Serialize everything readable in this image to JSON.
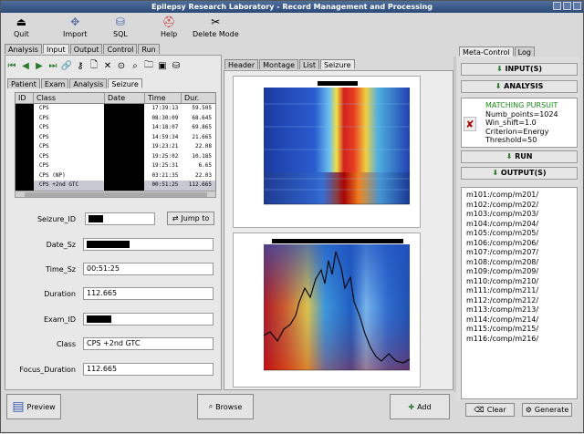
{
  "window": {
    "title": "Epilepsy Research Laboratory - Record Management and Processing"
  },
  "toolbar": [
    {
      "label": "Quit",
      "icon": "quit-icon"
    },
    {
      "label": "Import",
      "icon": "import-icon"
    },
    {
      "label": "SQL",
      "icon": "database-icon"
    },
    {
      "label": "Help",
      "icon": "help-icon"
    },
    {
      "label": "Delete Mode",
      "icon": "delete-mode-icon"
    }
  ],
  "main_tabs": [
    "Analysis",
    "Input",
    "Output",
    "Control",
    "Run"
  ],
  "sub_tabs": [
    "Patient",
    "Exam",
    "Analysis",
    "Seizure"
  ],
  "view_tabs": [
    "Header",
    "Montage",
    "List",
    "Seizure"
  ],
  "table": {
    "headers": [
      "ID",
      "Class",
      "Date",
      "Time",
      "Dur."
    ],
    "rows": [
      {
        "class": "CPS",
        "time": "17:39:13",
        "dur": "59.505"
      },
      {
        "class": "CPS",
        "time": "08:30:09",
        "dur": "68.645"
      },
      {
        "class": "CPS",
        "time": "14:18:07",
        "dur": "69.865"
      },
      {
        "class": "CPS",
        "time": "14:59:34",
        "dur": "21.665"
      },
      {
        "class": "CPS",
        "time": "19:23:21",
        "dur": "22.08"
      },
      {
        "class": "CPS",
        "time": "19:25:02",
        "dur": "10.185"
      },
      {
        "class": "CPS",
        "time": "19:25:31",
        "dur": "6.65"
      },
      {
        "class": "CPS (NP)",
        "time": "03:21:35",
        "dur": "22.03"
      },
      {
        "class": "CPS +2nd GTC",
        "time": "00:51:25",
        "dur": "112.665"
      }
    ]
  },
  "form": {
    "seizure_id_label": "Seizure_ID",
    "jump_label": "Jump to",
    "date_label": "Date_Sz",
    "time_label": "Time_Sz",
    "time_value": "00:51:25",
    "duration_label": "Duration",
    "duration_value": "112.665",
    "exam_label": "Exam_ID",
    "class_label": "Class",
    "class_value": "CPS +2nd GTC",
    "focus_label": "Focus_Duration",
    "focus_value": "112.665"
  },
  "bottom": {
    "preview": "Preview",
    "browse": "Browse",
    "add": "Add"
  },
  "right_panel": {
    "tabs": [
      "Meta-Control",
      "Log"
    ],
    "inputs_label": "INPUT(S)",
    "analysis_label": "ANALYSIS",
    "run_label": "RUN",
    "outputs_label": "OUTPUT(S)",
    "method": {
      "title": "MATCHING PURSUIT",
      "lines": [
        "Numb_points=1024",
        "Win_shift=1.0",
        "Criterion=Energy",
        "Threshold=50"
      ]
    },
    "outputs": [
      "m101:/comp/m201/",
      "m102:/comp/m202/",
      "m103:/comp/m203/",
      "m104:/comp/m204/",
      "m105:/comp/m205/",
      "m106:/comp/m206/",
      "m107:/comp/m207/",
      "m108:/comp/m208/",
      "m109:/comp/m209/",
      "m110:/comp/m210/",
      "m111:/comp/m211/",
      "m112:/comp/m212/",
      "m113:/comp/m213/",
      "m114:/comp/m214/",
      "m115:/comp/m215/",
      "m116:/comp/m216/"
    ],
    "clear_label": "Clear",
    "generate_label": "Generate"
  },
  "colors": {
    "title_bar": "#2c4a78",
    "panel_bg": "#d9d9d9"
  }
}
